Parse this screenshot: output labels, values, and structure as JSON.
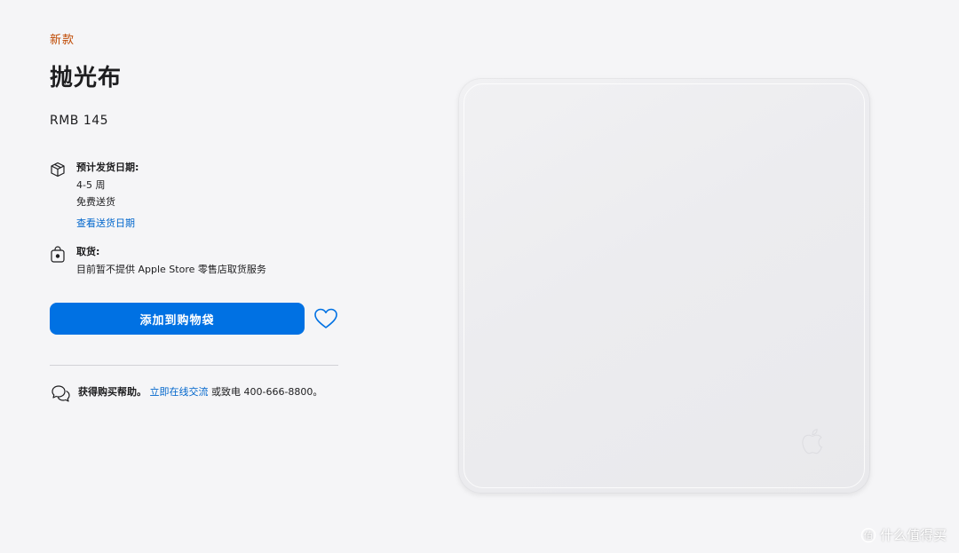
{
  "product": {
    "badge": "新款",
    "title": "抛光布",
    "price": "RMB 145"
  },
  "shipping": {
    "icon": "box-icon",
    "title": "预计发货日期:",
    "eta": "4-5 周",
    "free": "免费送货",
    "link": "查看送货日期"
  },
  "pickup": {
    "icon": "store-bag-icon",
    "title": "取货:",
    "note": "目前暂不提供 Apple Store 零售店取货服务"
  },
  "actions": {
    "add_to_bag": "添加到购物袋",
    "favorite_icon": "heart-icon",
    "accent_color": "#0071e3"
  },
  "help": {
    "icon": "chat-bubbles-icon",
    "lead": "获得购买帮助。",
    "link": "立即在线交流",
    "tail": "或致电 400-666-8800。"
  },
  "watermark": {
    "icon": "watermark-icon",
    "text": "什么值得买"
  },
  "colors": {
    "badge": "#bf4800",
    "link": "#0066cc",
    "background": "#f5f5f7"
  }
}
